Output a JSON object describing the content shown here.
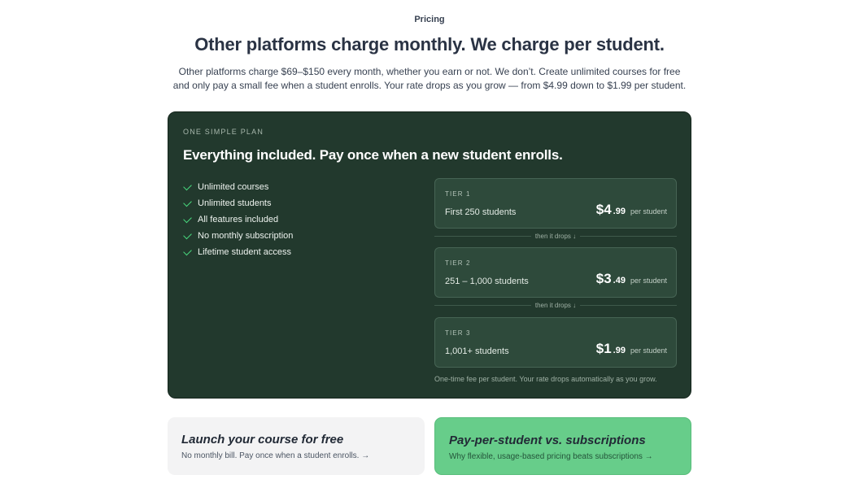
{
  "header": {
    "eyebrow": "Pricing",
    "title": "Other platforms charge monthly. We charge per student.",
    "intro": "Other platforms charge $69–$150 every month, whether you earn or not. We don’t. Create unlimited courses for free and only pay a small fee when a student enrolls. Your rate drops as you grow — from $4.99 down to $1.99 per student."
  },
  "plan": {
    "eyebrow": "ONE SIMPLE PLAN",
    "title": "Everything included. Pay once when a new student enrolls.",
    "features": [
      "Unlimited courses",
      "Unlimited students",
      "All features included",
      "No monthly subscription",
      "Lifetime student access"
    ],
    "tiers": [
      {
        "label": "TIER 1",
        "range": "First 250 students",
        "price": "$4",
        "cents": ".99",
        "unit": "per student"
      },
      {
        "label": "TIER 2",
        "range": "251 – 1,000 students",
        "price": "$3",
        "cents": ".49",
        "unit": "per student"
      },
      {
        "label": "TIER 3",
        "range": "1,001+ students",
        "price": "$1",
        "cents": ".99",
        "unit": "per student"
      }
    ],
    "divider_text": "then it drops ↓",
    "footnote": "One-time fee per student. Your rate drops automatically as you grow.",
    "accent_color": "#4ade80"
  },
  "cards": [
    {
      "title": "Launch your course for free",
      "subtitle": "No monthly bill. Pay once when a student enrolls. →"
    },
    {
      "title": "Pay-per-student vs. subscriptions",
      "subtitle": "Why flexible, usage-based pricing beats subscriptions →"
    }
  ]
}
